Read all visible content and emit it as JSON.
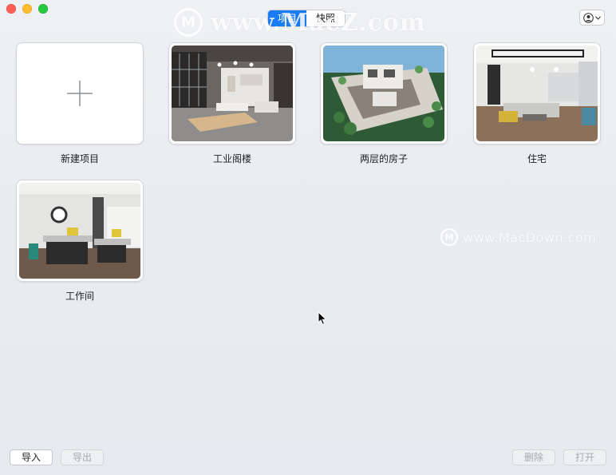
{
  "titlebar": {
    "tabs": [
      {
        "label": "项目",
        "active": true
      },
      {
        "label": "快照",
        "active": false
      }
    ],
    "user_icon": "person-circle-icon",
    "watermark": {
      "logo": "M",
      "text": "www.MacZ.com"
    }
  },
  "projects": [
    {
      "label": "新建项目",
      "thumbnail": "plus-icon"
    },
    {
      "label": "工业阁楼",
      "thumbnail": "industrial-loft-render"
    },
    {
      "label": "两层的房子",
      "thumbnail": "two-story-house-render"
    },
    {
      "label": "住宅",
      "thumbnail": "residence-render"
    },
    {
      "label": "工作间",
      "thumbnail": "workspace-render"
    }
  ],
  "watermark_mid": {
    "logo": "M",
    "text": "www.MacDown.com"
  },
  "footer": {
    "import_label": "导入",
    "export_label": "导出",
    "delete_label": "删除",
    "open_label": "打开"
  },
  "colors": {
    "accent": "#1a7cf5",
    "close": "#fe5f57",
    "minimize": "#febc2e",
    "maximize": "#28c840"
  }
}
